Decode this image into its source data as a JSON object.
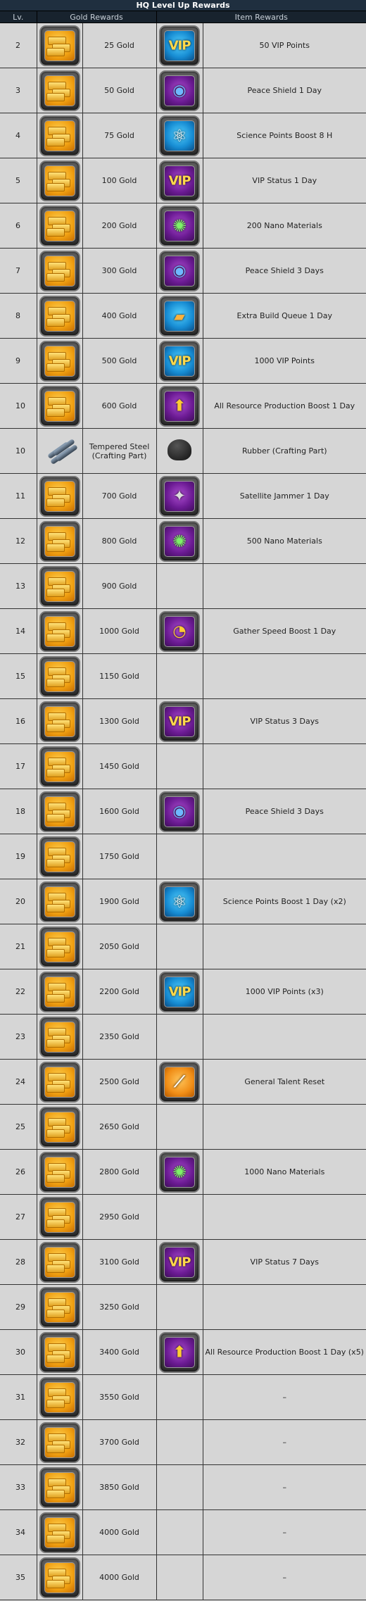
{
  "title": "HQ Level Up Rewards",
  "headers": {
    "lv": "Lv.",
    "gold": "Gold Rewards",
    "items": "Item Rewards"
  },
  "rows": [
    {
      "lv": "2",
      "gold_icon": "gold-bars-icon",
      "gold": "25 Gold",
      "item_icon": "vip-icon",
      "item": "50 VIP Points"
    },
    {
      "lv": "3",
      "gold_icon": "gold-bars-icon",
      "gold": "50 Gold",
      "item_icon": "peace-shield-icon",
      "item": "Peace Shield 1 Day"
    },
    {
      "lv": "4",
      "gold_icon": "gold-bars-icon",
      "gold": "75 Gold",
      "item_icon": "science-boost-icon",
      "item": "Science Points Boost 8 H"
    },
    {
      "lv": "5",
      "gold_icon": "gold-bars-icon",
      "gold": "100 Gold",
      "item_icon": "vip-status-icon",
      "item": "VIP Status 1 Day"
    },
    {
      "lv": "6",
      "gold_icon": "gold-bars-icon",
      "gold": "200 Gold",
      "item_icon": "nano-materials-icon",
      "item": "200 Nano Materials"
    },
    {
      "lv": "7",
      "gold_icon": "gold-bars-icon",
      "gold": "300 Gold",
      "item_icon": "peace-shield-icon",
      "item": "Peace Shield 3 Days"
    },
    {
      "lv": "8",
      "gold_icon": "gold-bars-icon",
      "gold": "400 Gold",
      "item_icon": "build-queue-icon",
      "item": "Extra Build Queue 1 Day"
    },
    {
      "lv": "9",
      "gold_icon": "gold-bars-icon",
      "gold": "500 Gold",
      "item_icon": "vip-icon",
      "item": "1000 VIP Points"
    },
    {
      "lv": "10",
      "gold_icon": "gold-bars-icon",
      "gold": "600 Gold",
      "item_icon": "resource-boost-icon",
      "item": "All Resource Production Boost 1 Day"
    },
    {
      "lv": "10",
      "gold_icon": "tempered-steel-icon",
      "gold": "Tempered Steel (Crafting Part)",
      "item_icon": "rubber-icon",
      "item": "Rubber (Crafting Part)"
    },
    {
      "lv": "11",
      "gold_icon": "gold-bars-icon",
      "gold": "700 Gold",
      "item_icon": "satellite-jammer-icon",
      "item": "Satellite Jammer 1 Day"
    },
    {
      "lv": "12",
      "gold_icon": "gold-bars-icon",
      "gold": "800 Gold",
      "item_icon": "nano-materials-icon",
      "item": "500 Nano Materials"
    },
    {
      "lv": "13",
      "gold_icon": "gold-bars-icon",
      "gold": "900 Gold",
      "item_icon": "",
      "item": ""
    },
    {
      "lv": "14",
      "gold_icon": "gold-bars-icon",
      "gold": "1000 Gold",
      "item_icon": "gather-speed-icon",
      "item": "Gather Speed Boost 1 Day"
    },
    {
      "lv": "15",
      "gold_icon": "gold-bars-icon",
      "gold": "1150 Gold",
      "item_icon": "",
      "item": ""
    },
    {
      "lv": "16",
      "gold_icon": "gold-bars-icon",
      "gold": "1300 Gold",
      "item_icon": "vip-status-icon",
      "item": "VIP Status 3 Days"
    },
    {
      "lv": "17",
      "gold_icon": "gold-bars-icon",
      "gold": "1450 Gold",
      "item_icon": "",
      "item": ""
    },
    {
      "lv": "18",
      "gold_icon": "gold-bars-icon",
      "gold": "1600 Gold",
      "item_icon": "peace-shield-icon",
      "item": "Peace Shield 3 Days"
    },
    {
      "lv": "19",
      "gold_icon": "gold-bars-icon",
      "gold": "1750 Gold",
      "item_icon": "",
      "item": ""
    },
    {
      "lv": "20",
      "gold_icon": "gold-bars-icon",
      "gold": "1900 Gold",
      "item_icon": "science-boost-icon",
      "item": "Science Points Boost 1 Day (x2)"
    },
    {
      "lv": "21",
      "gold_icon": "gold-bars-icon",
      "gold": "2050 Gold",
      "item_icon": "",
      "item": ""
    },
    {
      "lv": "22",
      "gold_icon": "gold-bars-icon",
      "gold": "2200 Gold",
      "item_icon": "vip-icon",
      "item": "1000 VIP Points (x3)"
    },
    {
      "lv": "23",
      "gold_icon": "gold-bars-icon",
      "gold": "2350 Gold",
      "item_icon": "",
      "item": ""
    },
    {
      "lv": "24",
      "gold_icon": "gold-bars-icon",
      "gold": "2500 Gold",
      "item_icon": "talent-reset-icon",
      "item": "General Talent Reset"
    },
    {
      "lv": "25",
      "gold_icon": "gold-bars-icon",
      "gold": "2650 Gold",
      "item_icon": "",
      "item": ""
    },
    {
      "lv": "26",
      "gold_icon": "gold-bars-icon",
      "gold": "2800 Gold",
      "item_icon": "nano-materials-icon",
      "item": "1000 Nano Materials"
    },
    {
      "lv": "27",
      "gold_icon": "gold-bars-icon",
      "gold": "2950 Gold",
      "item_icon": "",
      "item": ""
    },
    {
      "lv": "28",
      "gold_icon": "gold-bars-icon",
      "gold": "3100 Gold",
      "item_icon": "vip-status-icon",
      "item": "VIP Status 7 Days"
    },
    {
      "lv": "29",
      "gold_icon": "gold-bars-icon",
      "gold": "3250 Gold",
      "item_icon": "",
      "item": ""
    },
    {
      "lv": "30",
      "gold_icon": "gold-bars-icon",
      "gold": "3400 Gold",
      "item_icon": "resource-boost-icon",
      "item": "All Resource Production Boost 1 Day (x5)"
    },
    {
      "lv": "31",
      "gold_icon": "gold-bars-icon",
      "gold": "3550 Gold",
      "item_icon": "",
      "item": "–"
    },
    {
      "lv": "32",
      "gold_icon": "gold-bars-icon",
      "gold": "3700 Gold",
      "item_icon": "",
      "item": "–"
    },
    {
      "lv": "33",
      "gold_icon": "gold-bars-icon",
      "gold": "3850 Gold",
      "item_icon": "",
      "item": "–"
    },
    {
      "lv": "34",
      "gold_icon": "gold-bars-icon",
      "gold": "4000 Gold",
      "item_icon": "",
      "item": "–"
    },
    {
      "lv": "35",
      "gold_icon": "gold-bars-icon",
      "gold": "4000 Gold",
      "item_icon": "",
      "item": "–"
    }
  ]
}
